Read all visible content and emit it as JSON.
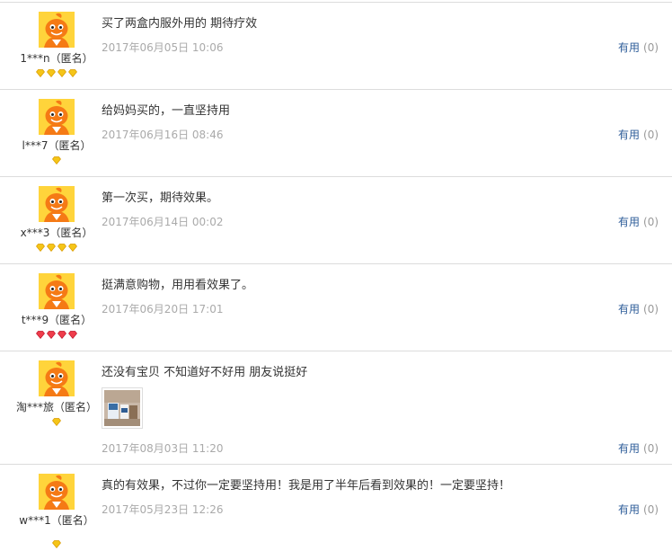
{
  "useful_label": "有用",
  "reviews": [
    {
      "user": "1***n（匿名）",
      "badges": [
        "gold",
        "gold",
        "gold",
        "gold"
      ],
      "content": "买了两盒内服外用的 期待疗效",
      "date": "2017年06月05日 10:06",
      "useful_count": "(0)",
      "has_photo": false
    },
    {
      "user": "l***7（匿名）",
      "badges": [
        "gold"
      ],
      "content": "给妈妈买的，一直坚持用",
      "date": "2017年06月16日 08:46",
      "useful_count": "(0)",
      "has_photo": false
    },
    {
      "user": "x***3（匿名）",
      "badges": [
        "gold",
        "gold",
        "gold",
        "gold"
      ],
      "content": "第一次买，期待效果。",
      "date": "2017年06月14日 00:02",
      "useful_count": "(0)",
      "has_photo": false
    },
    {
      "user": "t***9（匿名）",
      "badges": [
        "red",
        "red",
        "red",
        "red"
      ],
      "content": "挺满意购物，用用看效果了。",
      "date": "2017年06月20日 17:01",
      "useful_count": "(0)",
      "has_photo": false
    },
    {
      "user": "淘***旅（匿名）",
      "badges": [
        "gold"
      ],
      "content": "还没有宝贝 不知道好不好用 朋友说挺好",
      "date": "2017年08月03日 11:20",
      "useful_count": "(0)",
      "has_photo": true
    },
    {
      "user": "w***1（匿名）",
      "badges": [
        "gold"
      ],
      "content": "真的有效果，不过你一定要坚持用！我是用了半年后看到效果的！一定要坚持！",
      "date": "2017年05月23日 12:26",
      "useful_count": "(0)",
      "has_photo": false
    }
  ]
}
